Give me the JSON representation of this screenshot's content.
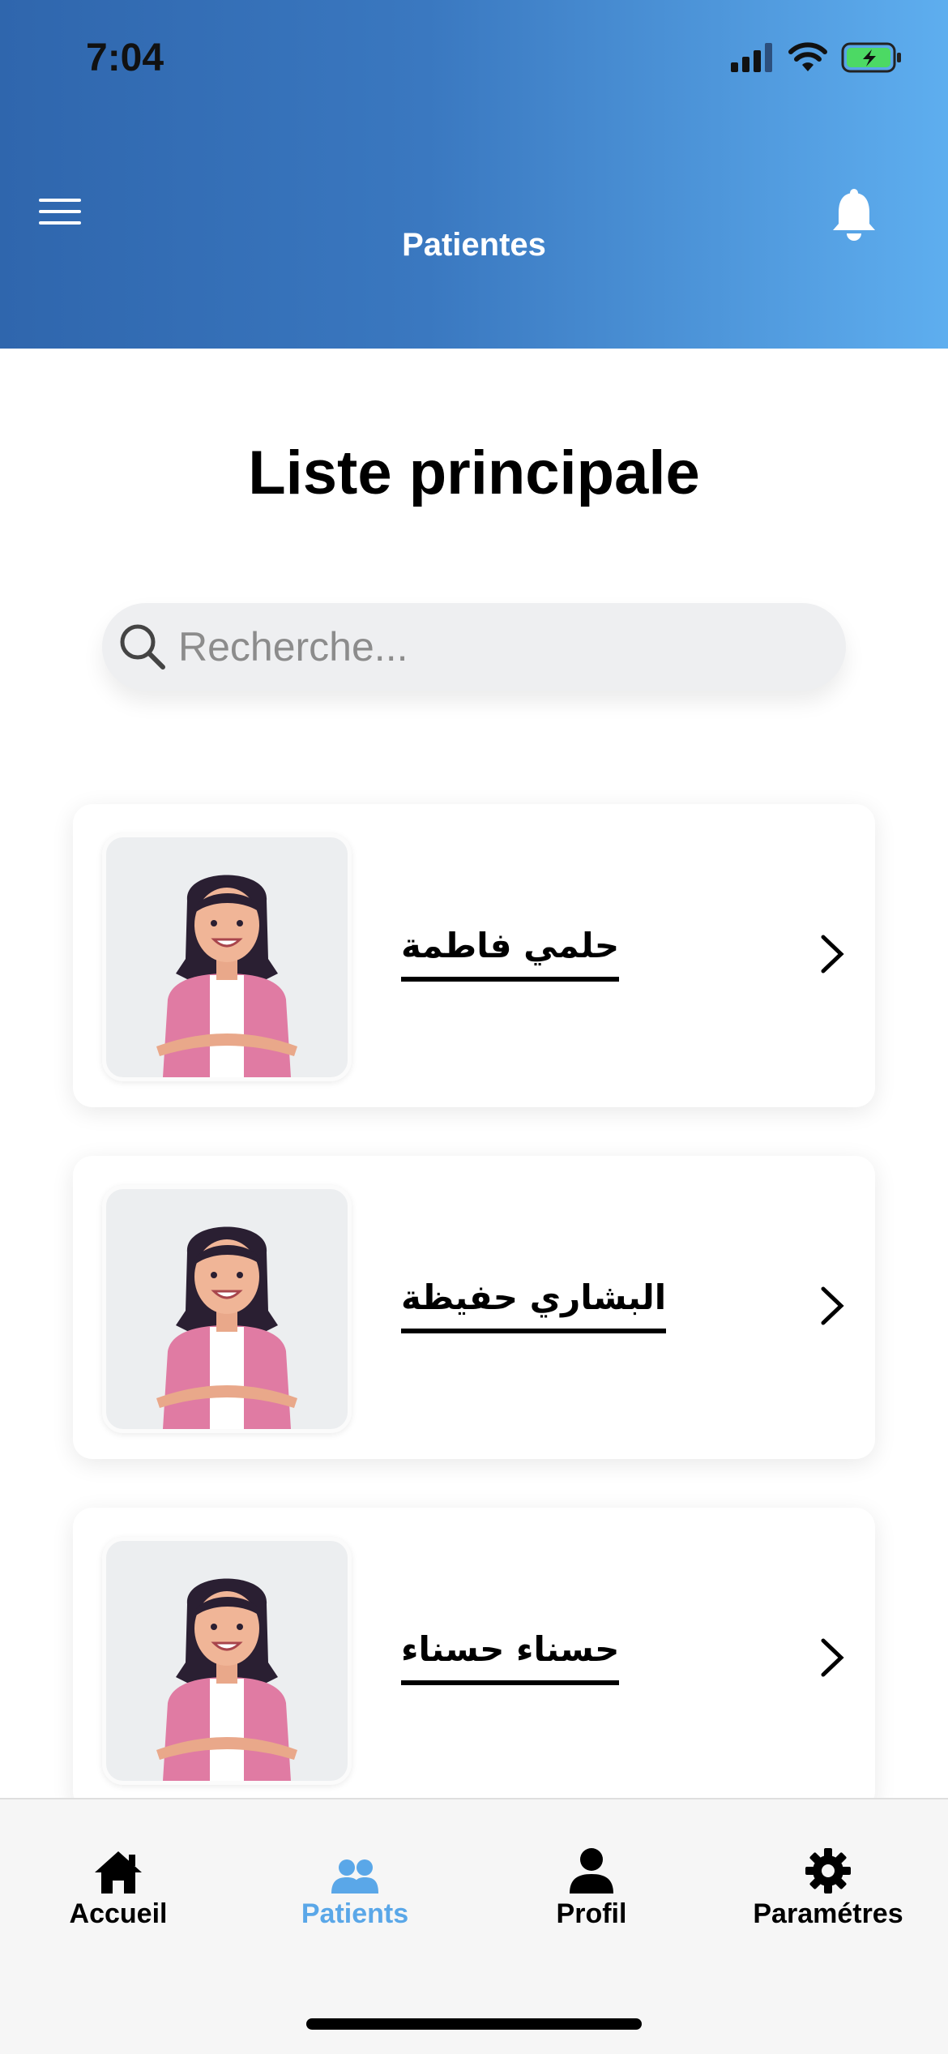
{
  "status_bar": {
    "time": "7:04"
  },
  "header": {
    "title": "Patientes",
    "menu_icon": "hamburger-menu-icon",
    "notification_icon": "bell-icon"
  },
  "main": {
    "title": "Liste principale",
    "search": {
      "placeholder": "Recherche...",
      "value": ""
    },
    "patients": [
      {
        "name": "حلمي فاطمة"
      },
      {
        "name": "البشاري حفيظة"
      },
      {
        "name": "حسناء حسناء"
      }
    ]
  },
  "tabbar": {
    "items": [
      {
        "label": "Accueil",
        "icon": "home-icon"
      },
      {
        "label": "Patients",
        "icon": "users-icon",
        "active": true
      },
      {
        "label": "Profil",
        "icon": "user-icon"
      },
      {
        "label": "Paramétres",
        "icon": "gear-icon"
      }
    ]
  },
  "colors": {
    "header_start": "#2f66ad",
    "header_end": "#5eaeef",
    "active_tab": "#5aa7e8",
    "battery_fill": "#4cd964"
  }
}
